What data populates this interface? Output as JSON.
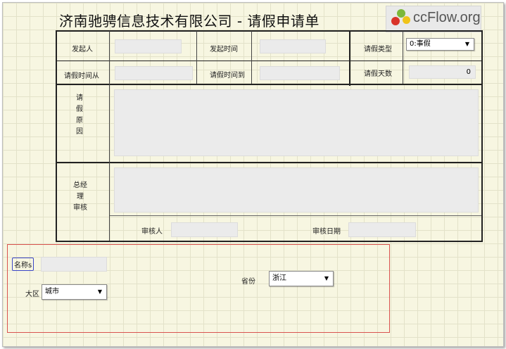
{
  "header": {
    "title": "济南驰骋信息技术有限公司 - 请假申请单",
    "logo_text": "ccFlow.org"
  },
  "colors": {
    "background": "#f7f6e1",
    "grid": "#e3e2c9",
    "field": "#ebebeb",
    "red_frame": "#d9534f",
    "label_frame": "#3a46c7"
  },
  "form": {
    "initiator_label": "发起人",
    "initiator_value": "",
    "start_time_label": "发起时间",
    "start_time_value": "",
    "leave_type_label": "请假类型",
    "leave_type_value": "0:事假",
    "leave_from_label": "请假时间从",
    "leave_from_value": "",
    "leave_to_label": "请假时间到",
    "leave_to_value": "",
    "leave_days_label": "请假天数",
    "leave_days_value": "0",
    "reason_label_chars": [
      "请",
      "假",
      "原",
      "因"
    ],
    "reason_value": "",
    "gm_label_chars": [
      "总经",
      "理",
      "审核"
    ],
    "gm_value": "",
    "reviewer_label": "审核人",
    "reviewer_value": "",
    "review_date_label": "审核日期",
    "review_date_value": ""
  },
  "extra": {
    "name_label": "名称s",
    "name_value": "",
    "district_label": "大区",
    "district_value": "城市",
    "province_label": "省份",
    "province_value": "浙江"
  },
  "icons": {
    "dropdown_arrow": "▼"
  }
}
